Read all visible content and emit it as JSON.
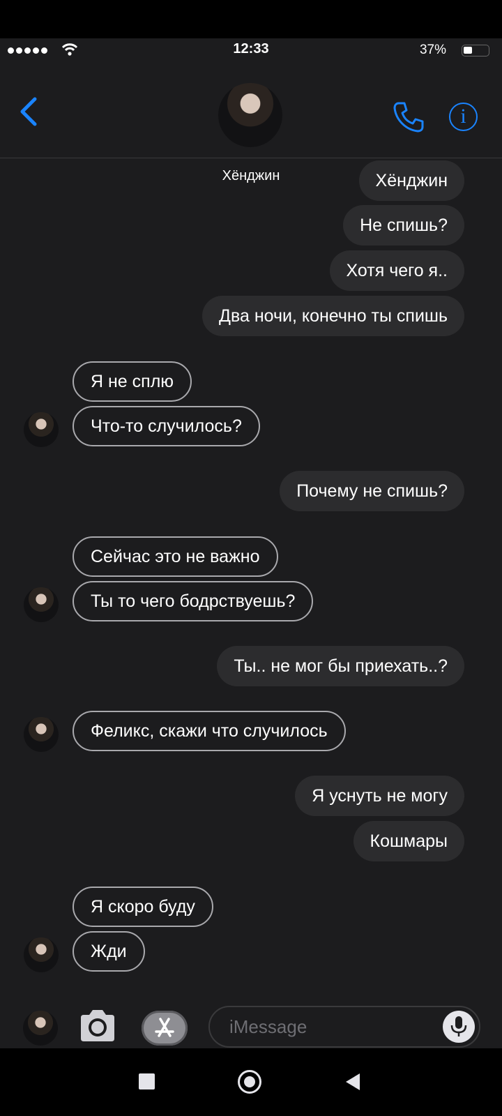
{
  "status_bar": {
    "time": "12:33",
    "battery": "37%"
  },
  "header": {
    "contact_name": "Хёнджин"
  },
  "messages": [
    {
      "side": "sent",
      "text": "Хёнджин"
    },
    {
      "side": "sent",
      "text": "Не спишь?"
    },
    {
      "side": "sent",
      "text": "Хотя чего я.."
    },
    {
      "side": "sent",
      "text": "Два ночи, конечно ты спишь"
    },
    {
      "side": "received",
      "text": "Я не сплю"
    },
    {
      "side": "received",
      "text": "Что-то случилось?"
    },
    {
      "side": "sent",
      "text": "Почему не спишь?"
    },
    {
      "side": "received",
      "text": "Сейчас это не важно"
    },
    {
      "side": "received",
      "text": "Ты то чего бодрствуешь?"
    },
    {
      "side": "sent",
      "text": "Ты.. не мог бы приехать..?"
    },
    {
      "side": "received",
      "text": "Феликс, скажи что случилось"
    },
    {
      "side": "sent",
      "text": "Я уснуть не могу"
    },
    {
      "side": "sent",
      "text": "Кошмары"
    },
    {
      "side": "received",
      "text": "Я скоро буду"
    },
    {
      "side": "received",
      "text": "Жди"
    }
  ],
  "compose": {
    "placeholder": "iMessage"
  },
  "colors": {
    "accent": "#1a84ff",
    "background": "#1c1c1e",
    "sent_bubble": "#2c2c2e"
  }
}
